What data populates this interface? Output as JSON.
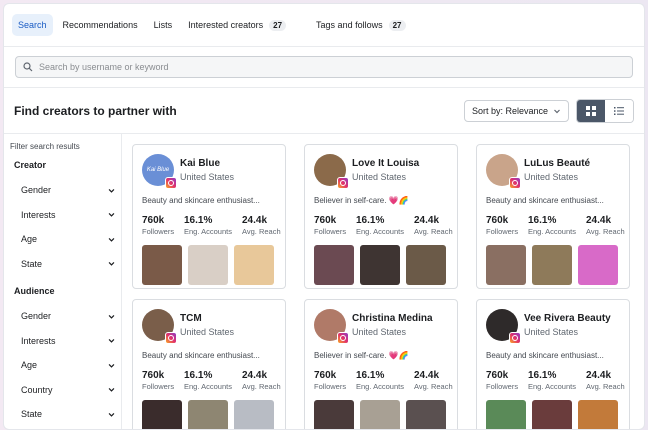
{
  "tabs": [
    {
      "label": "Search",
      "badge": ""
    },
    {
      "label": "Recommendations",
      "badge": ""
    },
    {
      "label": "Lists",
      "badge": ""
    },
    {
      "label": "Interested creators",
      "badge": "27"
    },
    {
      "label": "Tags and follows",
      "badge": "27"
    }
  ],
  "search": {
    "placeholder": "Search by username or keyword"
  },
  "header": {
    "title": "Find creators to partner with",
    "sort_label": "Sort by: Relevance"
  },
  "sidebar": {
    "filter_title": "Filter search results",
    "creator_title": "Creator",
    "creator_items": [
      "Gender",
      "Interests",
      "Age",
      "State"
    ],
    "audience_title": "Audience",
    "audience_items": [
      "Gender",
      "Interests",
      "Age",
      "Country",
      "State"
    ]
  },
  "stat_labels": {
    "followers": "Followers",
    "engagement": "Eng. Accounts",
    "reach": "Avg. Reach"
  },
  "creators": [
    {
      "name": "Kai Blue",
      "country": "United States",
      "bio": "Beauty and skincare enthusiast...",
      "followers": "760k",
      "engagement": "16.1%",
      "reach": "24.4k",
      "avatar_color": "#6a8fd6",
      "avatar_text": "Kai Blue",
      "thumbs": [
        "#7a5a48",
        "#d9cfc6",
        "#e8c89a"
      ]
    },
    {
      "name": "Love It Louisa",
      "country": "United States",
      "bio": "Believer in self-care. 💗🌈",
      "followers": "760k",
      "engagement": "16.1%",
      "reach": "24.4k",
      "avatar_color": "#8b6a4a",
      "avatar_text": "",
      "thumbs": [
        "#6b4a52",
        "#3e3432",
        "#6b5a48"
      ]
    },
    {
      "name": "LuLus Beauté",
      "country": "United States",
      "bio": "Beauty and skincare enthusiast...",
      "followers": "760k",
      "engagement": "16.1%",
      "reach": "24.4k",
      "avatar_color": "#c9a48a",
      "avatar_text": "",
      "thumbs": [
        "#8a6f62",
        "#8e7a5a",
        "#d86ac8"
      ]
    },
    {
      "name": "TCM",
      "country": "United States",
      "bio": "Beauty and skincare enthusiast...",
      "followers": "760k",
      "engagement": "16.1%",
      "reach": "24.4k",
      "avatar_color": "#7a5e4a",
      "avatar_text": "",
      "thumbs": [
        "#3a2c2c",
        "#8e8672",
        "#b8bcc4"
      ]
    },
    {
      "name": "Christina Medina",
      "country": "United States",
      "bio": "Believer in self-care. 💗🌈",
      "followers": "760k",
      "engagement": "16.1%",
      "reach": "24.4k",
      "avatar_color": "#b07a68",
      "avatar_text": "",
      "thumbs": [
        "#4a3a3a",
        "#a8a094",
        "#5a5050"
      ]
    },
    {
      "name": "Vee Rivera Beauty",
      "country": "United States",
      "bio": "Beauty and skincare enthusiast...",
      "followers": "760k",
      "engagement": "16.1%",
      "reach": "24.4k",
      "avatar_color": "#2e2a2a",
      "avatar_text": "",
      "thumbs": [
        "#5a8a58",
        "#6a3c3c",
        "#c27a3a"
      ]
    }
  ]
}
